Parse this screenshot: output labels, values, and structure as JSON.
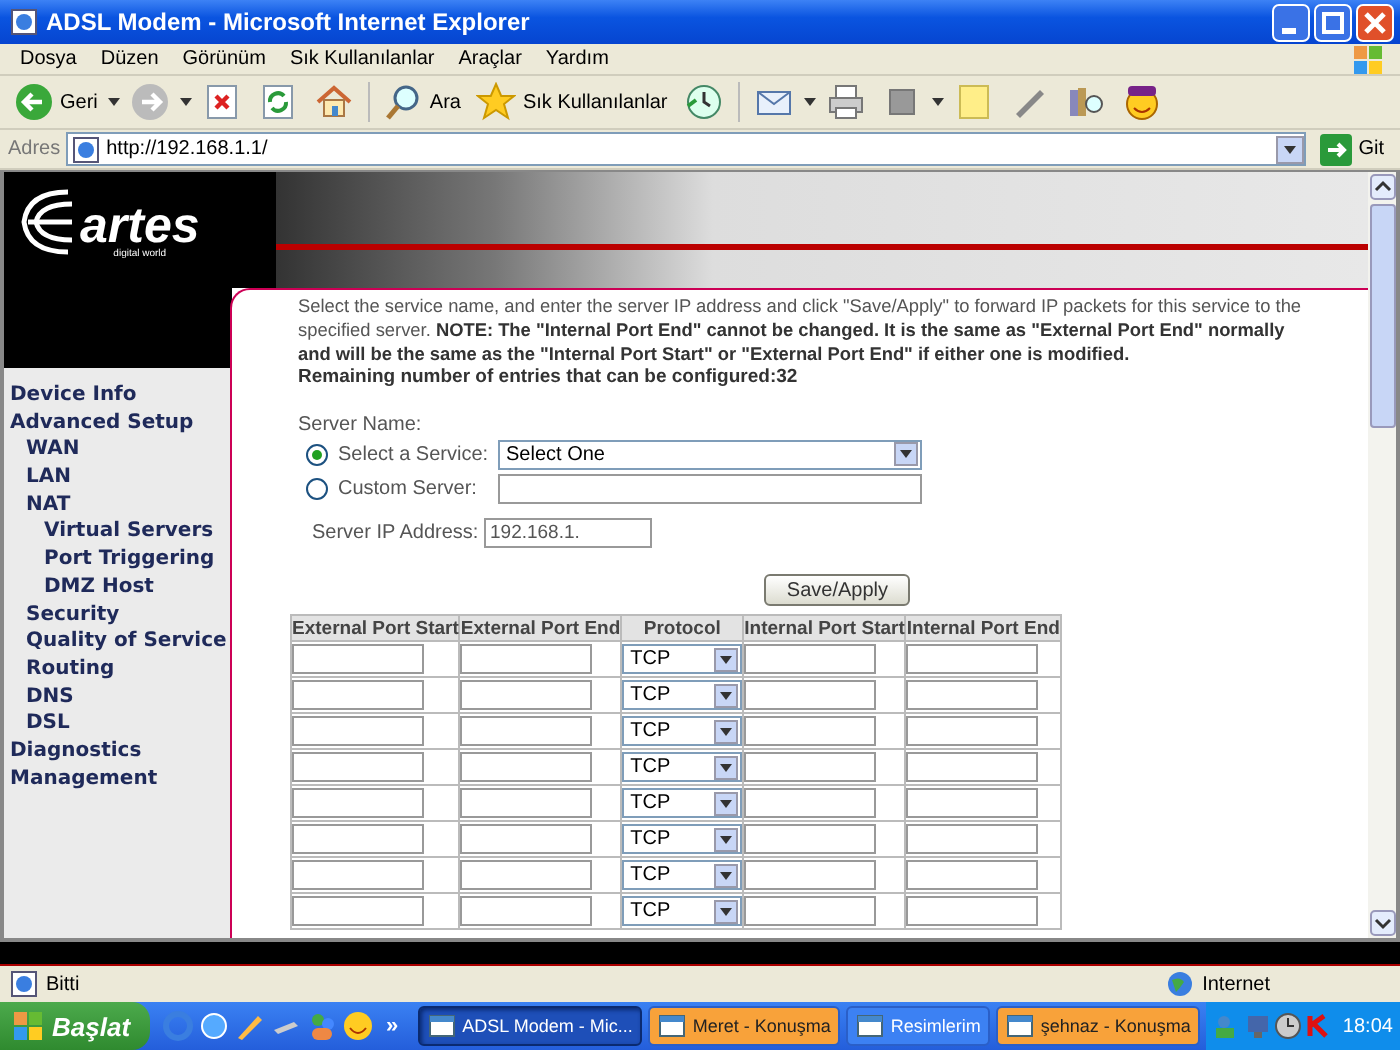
{
  "window": {
    "title": "ADSL Modem - Microsoft Internet Explorer"
  },
  "menu": [
    "Dosya",
    "Düzen",
    "Görünüm",
    "Sık Kullanılanlar",
    "Araçlar",
    "Yardım"
  ],
  "toolbar": [
    {
      "kind": "back",
      "label": "Geri"
    },
    {
      "kind": "forward"
    },
    {
      "kind": "stop"
    },
    {
      "kind": "refresh"
    },
    {
      "kind": "home"
    },
    {
      "kind": "search",
      "label": "Ara"
    },
    {
      "kind": "favorites",
      "label": "Sık Kullanılanlar"
    },
    {
      "kind": "history"
    },
    {
      "kind": "mail"
    },
    {
      "kind": "print"
    },
    {
      "kind": "edit"
    },
    {
      "kind": "note"
    },
    {
      "kind": "messenger"
    },
    {
      "kind": "research"
    },
    {
      "kind": "smiley"
    }
  ],
  "address": {
    "label": "Adres",
    "value": "http://192.168.1.1/",
    "go": "Git"
  },
  "logo": {
    "brand": "artes",
    "tagline": "digital world"
  },
  "sidebar": [
    {
      "label": "Device Info"
    },
    {
      "label": "Advanced Setup",
      "children": [
        {
          "label": "WAN"
        },
        {
          "label": "LAN"
        },
        {
          "label": "NAT",
          "children": [
            {
              "label": "Virtual Servers"
            },
            {
              "label": "Port Triggering"
            },
            {
              "label": "DMZ Host"
            }
          ]
        },
        {
          "label": "Security"
        },
        {
          "label": "Quality of Service"
        },
        {
          "label": "Routing"
        },
        {
          "label": "DNS"
        },
        {
          "label": "DSL"
        }
      ]
    },
    {
      "label": "Diagnostics"
    },
    {
      "label": "Management"
    }
  ],
  "intro": "Select the service name, and enter the server IP address and click \"Save/Apply\" to forward IP packets for this service to the specified server. **NOTE: The \"Internal Port End\" cannot be changed. It is the same as \"External Port End\" normally and will be the same as the \"Internal Port Start\" or \"External Port End\" if either one is modified.**",
  "remaining": "Remaining number of entries that can be configured:32",
  "server_name_label": "Server Name:",
  "server_options": [
    {
      "kind": "select",
      "label": "Select a Service:",
      "value": "Select One",
      "selected": true
    },
    {
      "kind": "text",
      "label": "Custom Server:",
      "selected": false
    }
  ],
  "server_ip": {
    "label": "Server IP Address:",
    "value": "192.168.1."
  },
  "save_button": "Save/Apply",
  "table": {
    "columns": [
      "External Port Start",
      "External Port End",
      "Protocol",
      "Internal Port Start",
      "Internal Port End"
    ],
    "rows": [
      {
        "protocol": "TCP"
      },
      {
        "protocol": "TCP"
      },
      {
        "protocol": "TCP"
      },
      {
        "protocol": "TCP"
      },
      {
        "protocol": "TCP"
      },
      {
        "protocol": "TCP"
      },
      {
        "protocol": "TCP"
      },
      {
        "protocol": "TCP"
      }
    ]
  },
  "status_bar": {
    "text": "Bitti",
    "zone": "Internet"
  },
  "taskbar": {
    "start": "Başlat",
    "quick_launch_more": "»",
    "tasks": [
      {
        "label": "ADSL Modem - Mic...",
        "selected": true,
        "flashing": false
      },
      {
        "label": "Meret - Konuşma",
        "selected": false,
        "flashing": true
      },
      {
        "label": "Resimlerim",
        "selected": false,
        "flashing": false
      },
      {
        "label": "şehnaz - Konuşma",
        "selected": false,
        "flashing": true
      }
    ],
    "clock": "18:04"
  }
}
